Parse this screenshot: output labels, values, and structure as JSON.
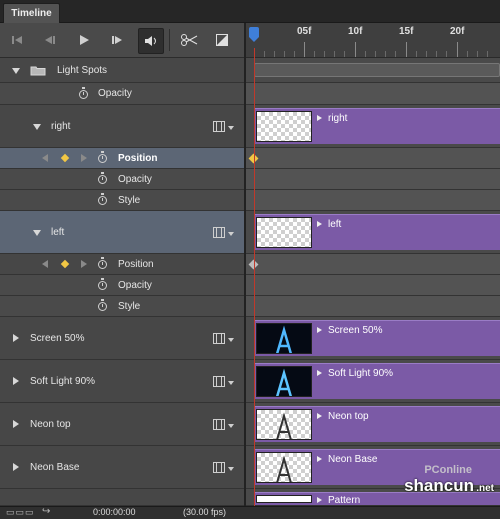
{
  "panel": {
    "tab_label": "Timeline"
  },
  "toolbar": {
    "buttons": [
      "go-to-first-frame-icon",
      "previous-frame-icon",
      "play-icon",
      "next-frame-icon",
      "audio-icon",
      "scissors-icon",
      "transition-icon"
    ]
  },
  "ruler": {
    "labels": [
      "05f",
      "10f",
      "15f",
      "20f"
    ]
  },
  "layers": {
    "light_spots": {
      "name": "Light Spots",
      "opacity": "Opacity"
    },
    "right": {
      "name": "right",
      "props": [
        "Position",
        "Opacity",
        "Style"
      ]
    },
    "left": {
      "name": "left",
      "props": [
        "Position",
        "Opacity",
        "Style"
      ]
    },
    "screen50": {
      "name": "Screen 50%"
    },
    "softlight90": {
      "name": "Soft Light 90%"
    },
    "neontop": {
      "name": "Neon top"
    },
    "neonbase": {
      "name": "Neon Base"
    }
  },
  "clips": {
    "right": "right",
    "left": "left",
    "screen50": "Screen 50%",
    "softlight90": "Soft Light 90%",
    "neontop": "Neon top",
    "neonbase": "Neon Base",
    "pattern": "Pattern"
  },
  "bottom": {
    "timecode": "0:00:00:00",
    "fps": "(30.00 fps)"
  },
  "watermark": {
    "brand": "PConline",
    "text": "shancun",
    "domain": ".net"
  },
  "colors": {
    "clip": "#7b5aa6",
    "playhead": "#c0392b",
    "selected_row": "#5c6675",
    "keyframe": "#f2c744"
  }
}
